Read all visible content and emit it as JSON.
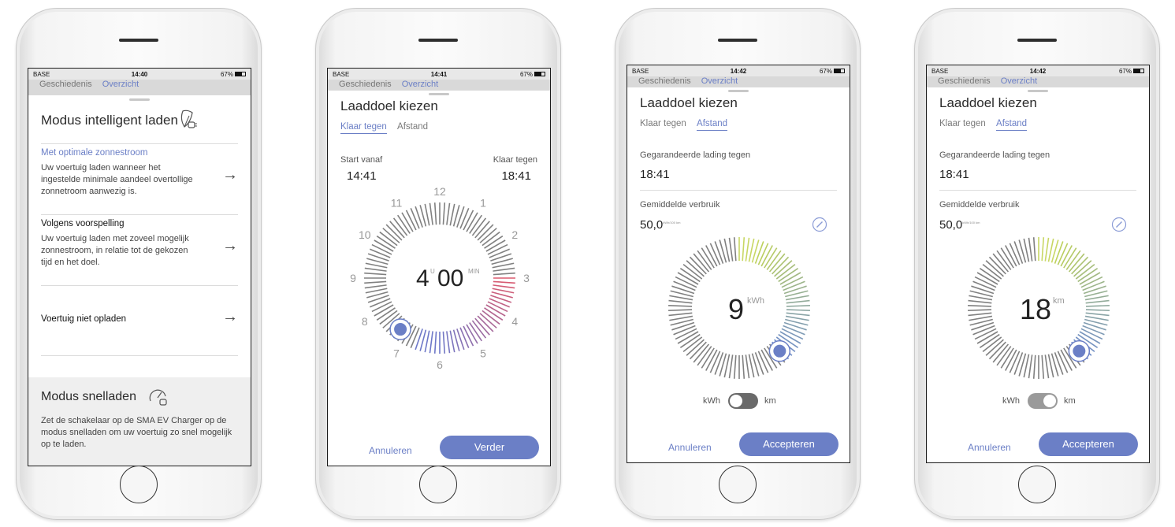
{
  "status": {
    "carrier": "BASE",
    "battery": "67%"
  },
  "behind_tabs": [
    "Geschiedenis",
    "Overzicht"
  ],
  "screen1": {
    "time": "14:40",
    "title": "Modus intelligent laden",
    "option1_title": "Met optimale zonnestroom",
    "option1_desc": "Uw voertuig laden wanneer het ingestelde minimale aandeel overtollige zonnetroom aanwezig is.",
    "option2_title": "Volgens voorspelling",
    "option2_desc": "Uw voertuig laden met zoveel mogelijk zonnestroom, in relatie tot de gekozen tijd en het doel.",
    "option3_title": "Voertuig niet opladen",
    "fast_title": "Modus snelladen",
    "fast_desc": "Zet de schakelaar op de SMA EV Charger op de modus snelladen om uw voertuig zo snel mogelijk op te laden."
  },
  "screen2": {
    "time": "14:41",
    "title": "Laaddoel kiezen",
    "tab1": "Klaar tegen",
    "tab2": "Afstand",
    "start_label": "Start vanaf",
    "start_value": "14:41",
    "ready_label": "Klaar tegen",
    "ready_value": "18:41",
    "hours": "4",
    "hours_unit": "U",
    "minutes": "00",
    "minutes_unit": "MIN",
    "clock_numbers": [
      "12",
      "1",
      "2",
      "3",
      "4",
      "5",
      "6",
      "7",
      "8",
      "9",
      "10",
      "11"
    ],
    "cancel": "Annuleren",
    "next": "Verder"
  },
  "screen3": {
    "time": "14:42",
    "title": "Laaddoel kiezen",
    "tab1": "Klaar tegen",
    "tab2": "Afstand",
    "guaranteed_label": "Gegarandeerde lading tegen",
    "guaranteed_value": "18:41",
    "consumption_label": "Gemiddelde verbruik",
    "consumption_value": "50,0",
    "consumption_unit": "kWh/100 km",
    "dial_value": "9",
    "dial_unit": "kWh",
    "toggle_left": "kWh",
    "toggle_right": "km",
    "cancel": "Annuleren",
    "accept": "Accepteren"
  },
  "screen4": {
    "time": "14:42",
    "title": "Laaddoel kiezen",
    "tab1": "Klaar tegen",
    "tab2": "Afstand",
    "guaranteed_label": "Gegarandeerde lading tegen",
    "guaranteed_value": "18:41",
    "consumption_label": "Gemiddelde verbruik",
    "consumption_value": "50,0",
    "consumption_unit": "kWh/100 km",
    "dial_value": "18",
    "dial_unit": "km",
    "toggle_left": "kWh",
    "toggle_right": "km",
    "cancel": "Annuleren",
    "accept": "Accepteren"
  },
  "colors": {
    "accent": "#6b7fc6",
    "dial_gray": "#8a8a8a"
  }
}
